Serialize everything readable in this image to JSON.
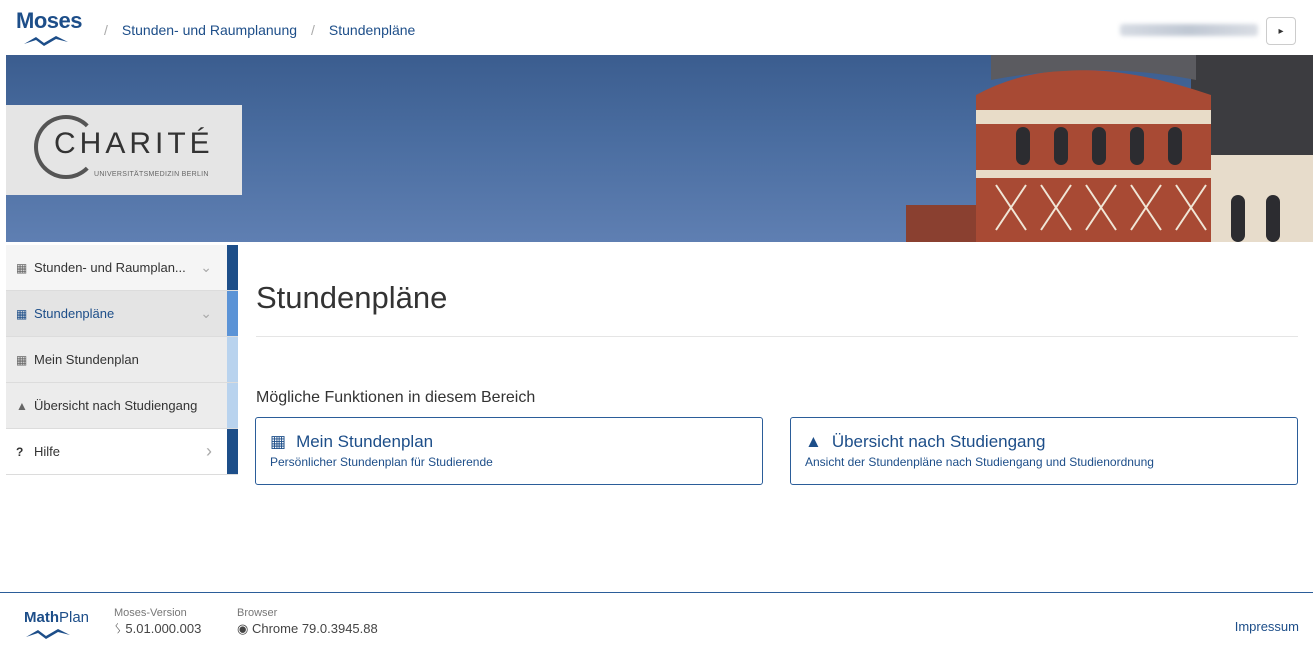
{
  "header": {
    "logo_text": "Moses",
    "breadcrumbs": [
      "Stunden- und Raumplanung",
      "Stundenpläne"
    ],
    "logout_icon": "sign-out-icon"
  },
  "banner": {
    "logo_name": "CHARITÉ",
    "logo_sub": "UNIVERSITÄTSMEDIZIN BERLIN"
  },
  "sidebar": {
    "items": [
      {
        "icon": "calendar-icon",
        "label": "Stunden- und Raumplan...",
        "chevron": "chevron-down-icon",
        "accent": "#1d4e89"
      },
      {
        "icon": "calendar-icon",
        "label": "Stundenpläne",
        "chevron": "chevron-down-icon",
        "accent": "#5b93d6"
      },
      {
        "icon": "calendar-icon",
        "label": "Mein Stundenplan",
        "accent": "#b9d3ee"
      },
      {
        "icon": "graduation-cap-icon",
        "label": "Übersicht nach Studiengang",
        "accent": "#b9d3ee"
      },
      {
        "icon": "question-icon",
        "label": "Hilfe",
        "chevron": "chevron-right-icon",
        "accent": "#1d4e89"
      }
    ]
  },
  "main": {
    "title": "Stundenpläne",
    "section_title": "Mögliche Funktionen in diesem Bereich",
    "cards": [
      {
        "icon": "calendar-icon",
        "title": "Mein Stundenplan",
        "subtitle": "Persönlicher Stundenplan für Studierende"
      },
      {
        "icon": "graduation-cap-icon",
        "title": "Übersicht nach Studiengang",
        "subtitle": "Ansicht der Stundenpläne nach Studiengang und Studienordnung"
      }
    ]
  },
  "footer": {
    "brand_bold": "Math",
    "brand_rest": "Plan",
    "version_label": "Moses-Version",
    "version_value": "5.01.000.003",
    "browser_label": "Browser",
    "browser_value": "Chrome 79.0.3945.88",
    "impressum": "Impressum"
  },
  "colors": {
    "brand": "#1d4e89",
    "banner_sky": "#4a6da0"
  }
}
